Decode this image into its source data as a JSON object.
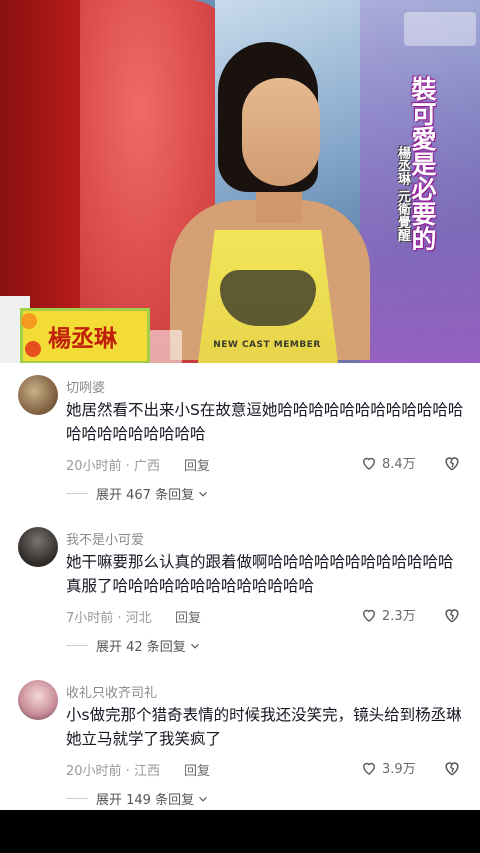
{
  "video": {
    "banner_title": "裝可愛是必要的",
    "banner_sub": "楊丞琳 元衛覺醒",
    "name_card": "楊丞琳",
    "shirt_text": "NEW CAST MEMBER"
  },
  "comments": [
    {
      "username": "切咧婆",
      "text": "她居然看不出来小S在故意逗她哈哈哈哈哈哈哈哈哈哈哈哈哈哈哈哈哈哈哈哈哈",
      "time": "20小时前 · 广西",
      "reply_label": "回复",
      "likes": "8.4万",
      "expand_label": "展开 467 条回复"
    },
    {
      "username": "我不是小可爱",
      "text": "她干嘛要那么认真的跟着做啊哈哈哈哈哈哈哈哈哈哈哈哈真服了哈哈哈哈哈哈哈哈哈哈哈哈哈",
      "time": "7小时前 · 河北",
      "reply_label": "回复",
      "likes": "2.3万",
      "expand_label": "展开 42 条回复"
    },
    {
      "username": "收礼只收齐司礼",
      "text": "小s做完那个猎奇表情的时候我还没笑完，镜头给到杨丞琳她立马就学了我笑疯了",
      "time": "20小时前 · 江西",
      "reply_label": "回复",
      "likes": "3.9万",
      "expand_label": "展开 149 条回复"
    }
  ],
  "colors": {
    "text_primary": "#161823",
    "text_secondary": "#8a8a8a",
    "panel_bg": "#ffffff"
  }
}
